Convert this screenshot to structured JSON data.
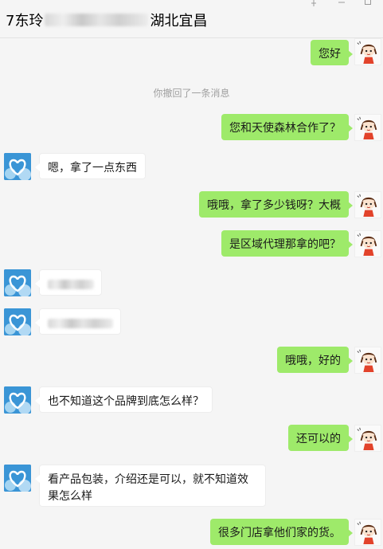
{
  "window": {
    "title_prefix": "7东玲",
    "title_suffix": "湖北宜昌",
    "pin_icon": "pin-icon",
    "minimize_icon": "minimize-icon",
    "maximize_icon": "maximize-icon"
  },
  "chat": {
    "recall_notice": "你撤回了一条消息",
    "messages": [
      {
        "side": "out",
        "text": "您好"
      },
      {
        "side": "out",
        "text": "您和天使森林合作了？"
      },
      {
        "side": "in",
        "text": "嗯，拿了一点东西"
      },
      {
        "side": "out",
        "text": "哦哦，拿了多少钱呀？大概"
      },
      {
        "side": "out",
        "text": "是区域代理那拿的吧？"
      },
      {
        "side": "in",
        "text": ""
      },
      {
        "side": "in",
        "text": ""
      },
      {
        "side": "out",
        "text": "哦哦，好的"
      },
      {
        "side": "in",
        "text": "也不知道这个品牌到底怎么样？"
      },
      {
        "side": "out",
        "text": "还可以的"
      },
      {
        "side": "in",
        "text": "看产品包装，介绍还是可以，就不知道效果怎么样"
      },
      {
        "side": "out",
        "text": "很多门店拿他们家的货。"
      }
    ]
  },
  "colors": {
    "outgoing_bubble": "#9eea6a",
    "incoming_bubble": "#ffffff",
    "background": "#f5f5f5"
  },
  "icons": {
    "contact_avatar": "heart-cloud-avatar-icon",
    "self_avatar": "cartoon-girl-avatar-icon"
  }
}
